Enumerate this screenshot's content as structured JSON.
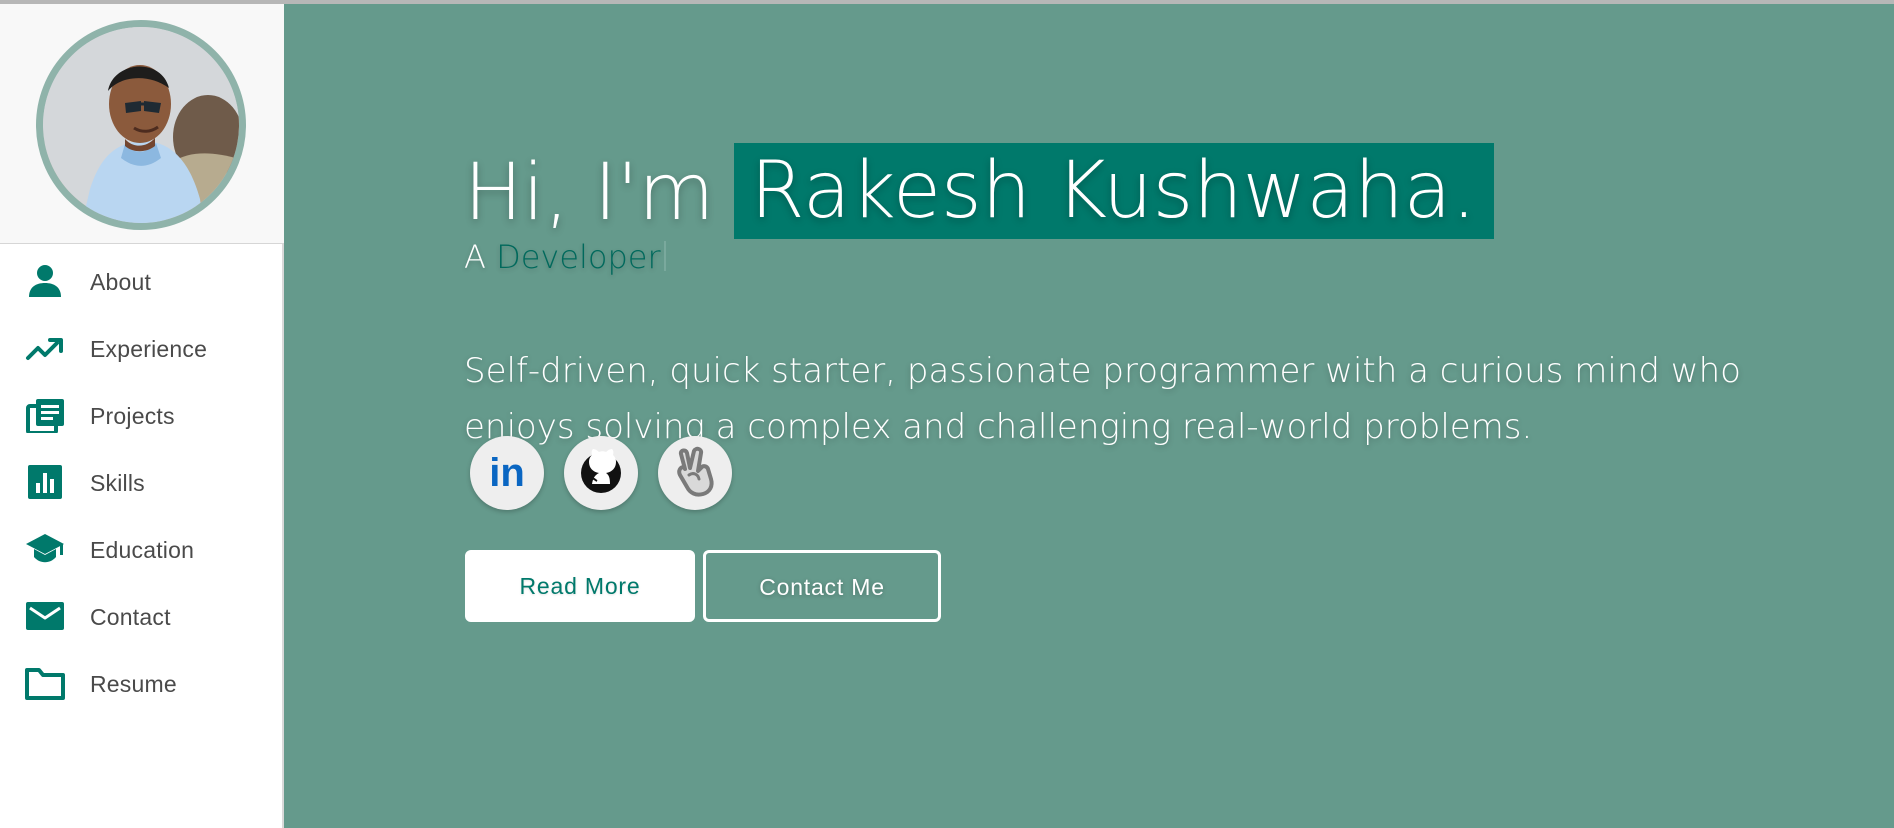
{
  "profile": {
    "avatar_alt": "Profile photo"
  },
  "sidebar": {
    "items": [
      {
        "label": "About",
        "icon": "person-icon"
      },
      {
        "label": "Experience",
        "icon": "trending-up-icon"
      },
      {
        "label": "Projects",
        "icon": "library-books-icon"
      },
      {
        "label": "Skills",
        "icon": "bar-chart-icon"
      },
      {
        "label": "Education",
        "icon": "graduation-cap-icon"
      },
      {
        "label": "Contact",
        "icon": "mail-icon"
      },
      {
        "label": "Resume",
        "icon": "folder-icon"
      }
    ]
  },
  "hero": {
    "greeting": "Hi, I'm",
    "name": "Rakesh Kushwaha.",
    "subtitle_prefix": "A",
    "role": "Developer",
    "intro": "Self-driven, quick starter, passionate programmer with a curious mind who enjoys solving a complex and challenging real-world problems.",
    "social_links": [
      {
        "name": "LinkedIn",
        "icon": "linkedin-icon",
        "icon_text": "in"
      },
      {
        "name": "GitHub",
        "icon": "github-icon"
      },
      {
        "name": "Victory",
        "icon": "victory-hand-icon"
      }
    ],
    "buttons": {
      "read_more": "Read More",
      "contact_me": "Contact Me"
    }
  },
  "colors": {
    "accent": "#00796b",
    "hero_background": "#659a8c",
    "sidebar_background": "#ffffff",
    "avatar_ring": "#8fb3aa",
    "linkedin_blue": "#0a66c2"
  }
}
